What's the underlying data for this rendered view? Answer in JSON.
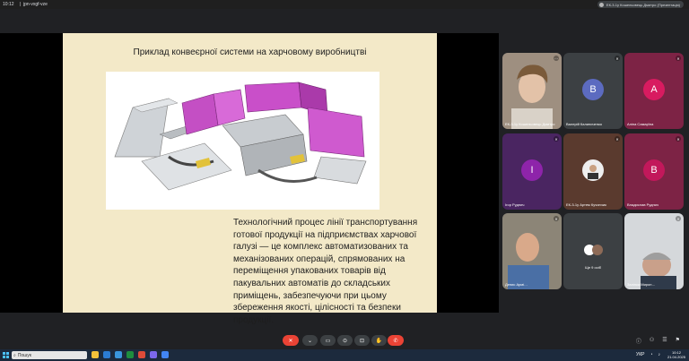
{
  "topbar": {
    "time": "10:12",
    "separator": "|",
    "meeting_code": "jpn-vxgf-vze",
    "presenter_chip": "ЕК-3-1у Кошельовець Дмитро (Презентація)"
  },
  "slide": {
    "title": "Приклад конвеєрної системи на харчовому виробництві",
    "text": "Технологічний процес лінії транспортування готової продукції на підприємствах харчової галузі — це комплекс автоматизованих та механізованих операцій, спрямованих на переміщення упакованих товарів від пакувальних автоматів до складських приміщень, забезпечуючи при цьому збереження якості, цілісності та безпеки продукції."
  },
  "participants": [
    {
      "name": "ЕК-3-1у Кошельовець Дмитро",
      "initial": "",
      "color": "#6b5a4a",
      "muted": false
    },
    {
      "name": "Валерій Калиниченко",
      "initial": "B",
      "color": "#5c6bc0",
      "muted": true
    },
    {
      "name": "Аліна Самарїна",
      "initial": "A",
      "color": "#d81b60",
      "muted": true
    },
    {
      "name": "Ігор Руднич",
      "initial": "I",
      "color": "#8e24aa",
      "muted": true
    },
    {
      "name": "ЕК-3-1у Артем Кучинчик",
      "initial": "",
      "color": "#5d4037",
      "muted": true
    },
    {
      "name": "Владислав Руднич",
      "initial": "B",
      "color": "#c2185b",
      "muted": true
    },
    {
      "name": "Денис Армі…",
      "initial": "",
      "color": "#8a8070",
      "muted": true
    },
    {
      "name": "Ще 9 осіб",
      "initial": "",
      "color": "#3c4043",
      "muted": false
    },
    {
      "name": "Залінка Мирон…",
      "initial": "",
      "color": "#a0a4a8",
      "muted": true
    }
  ],
  "controls": {
    "buttons": [
      "⌄",
      "✕",
      "⌄",
      "▭",
      "✋",
      "⊙",
      "⊡",
      "✋",
      "⋮"
    ],
    "leave": "✆",
    "right": [
      "ⓘ",
      "⚇",
      "☰",
      "⚑"
    ]
  },
  "taskbar": {
    "search_placeholder": "Пошук",
    "tray_lang": "УКР",
    "clock_time": "10:12",
    "clock_date": "21.04.2025"
  }
}
